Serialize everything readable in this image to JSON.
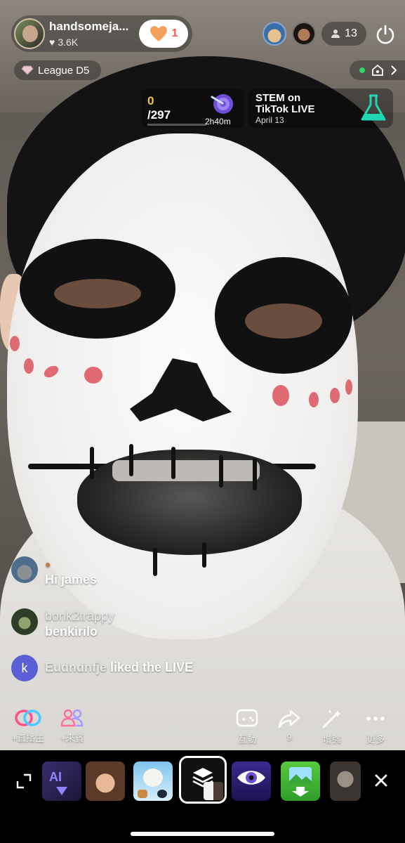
{
  "host": {
    "name": "handsomeja...",
    "likes": "3.6K",
    "follow_count": "1"
  },
  "viewers": {
    "count": "13"
  },
  "league": {
    "label": "League D5"
  },
  "goal": {
    "current": "0",
    "total": "/297",
    "time_left": "2h40m",
    "progress": 0
  },
  "promo": {
    "title": "STEM on TikTok LIVE",
    "date": "April 13"
  },
  "chat": [
    {
      "user": "",
      "message": "Hi james",
      "avatar_color": "#4f6e8e"
    },
    {
      "user": "bonk2trappy",
      "message": "benkirilo",
      "avatar_color": "#2f3d28"
    },
    {
      "user": "Eudndnfje",
      "message": " liked the LIVE",
      "avatar_letter": "k",
      "avatar_color": "#5a5fd6"
    }
  ],
  "actions": {
    "co_host": "+直播主",
    "guest": "+來賓",
    "interact": "互動",
    "share_count": "9",
    "enhance": "增強",
    "more": "更多"
  },
  "effects_tray": {
    "items": [
      "ai-effect-icon",
      "cartoon-girl-effect",
      "goat-effect",
      "layers-effect",
      "eye-effect",
      "image-download-effect",
      "mask-effect"
    ],
    "selected": "layers-effect"
  },
  "colors": {
    "accent_orange": "#ff5a45",
    "goal_gold": "#f3c64a",
    "live_green": "#35d46a"
  }
}
